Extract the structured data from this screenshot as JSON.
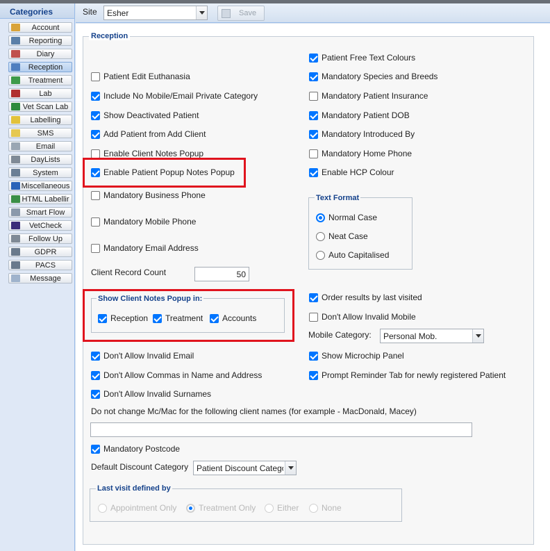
{
  "sidebar": {
    "title": "Categories",
    "items": [
      {
        "label": "Account",
        "icon": "account-icon",
        "color": "#d9a33a"
      },
      {
        "label": "Reporting",
        "icon": "reporting-icon",
        "color": "#5a7fa8"
      },
      {
        "label": "Diary",
        "icon": "diary-icon",
        "color": "#c0504d"
      },
      {
        "label": "Reception",
        "icon": "reception-icon",
        "color": "#4f7fc0",
        "active": true
      },
      {
        "label": "Treatment",
        "icon": "treatment-icon",
        "color": "#3d9a4a"
      },
      {
        "label": "Lab",
        "icon": "lab-icon",
        "color": "#b03030"
      },
      {
        "label": "Vet Scan Lab",
        "icon": "vetscan-icon",
        "color": "#2e8b3d"
      },
      {
        "label": "Labelling",
        "icon": "labelling-icon",
        "color": "#e2c23a"
      },
      {
        "label": "SMS",
        "icon": "sms-icon",
        "color": "#e6c850"
      },
      {
        "label": "Email",
        "icon": "email-icon",
        "color": "#9aa6b3"
      },
      {
        "label": "DayLists",
        "icon": "daylists-icon",
        "color": "#7f8a96"
      },
      {
        "label": "System",
        "icon": "system-icon",
        "color": "#6b7f95"
      },
      {
        "label": "Miscellaneous",
        "icon": "info-icon",
        "color": "#2a63b8"
      },
      {
        "label": "HTML Labellir",
        "icon": "html-labelling-icon",
        "color": "#3a8f46"
      },
      {
        "label": "Smart Flow",
        "icon": "smartflow-icon",
        "color": "#8a99ab"
      },
      {
        "label": "VetCheck",
        "icon": "vetcheck-icon",
        "color": "#3b2d7a"
      },
      {
        "label": "Follow Up",
        "icon": "followup-icon",
        "color": "#7f8a96"
      },
      {
        "label": "GDPR",
        "icon": "gdpr-icon",
        "color": "#6a7a8c"
      },
      {
        "label": "PACS",
        "icon": "pacs-icon",
        "color": "#6a7a8c"
      },
      {
        "label": "Message",
        "icon": "message-icon",
        "color": "#9fb3cc"
      }
    ]
  },
  "toolbar": {
    "site_label": "Site",
    "site_value": "Esher",
    "save_label": "Save"
  },
  "reception": {
    "legend": "Reception",
    "left": [
      {
        "label": "Patient Edit Euthanasia",
        "checked": false
      },
      {
        "label": "Include No Mobile/Email Private Category",
        "checked": true
      },
      {
        "label": "Show Deactivated Patient",
        "checked": true
      },
      {
        "label": "Add Patient from Add Client",
        "checked": true
      },
      {
        "label": "Enable Client Notes Popup",
        "checked": false
      },
      {
        "label": "Enable Patient Popup Notes Popup",
        "checked": true
      },
      {
        "label": "Mandatory Business Phone",
        "checked": false
      },
      {
        "label": "Mandatory Mobile Phone",
        "checked": false
      },
      {
        "label": "Mandatory Email Address",
        "checked": false
      }
    ],
    "right": [
      {
        "label": "Patient Free Text Colours",
        "checked": true
      },
      {
        "label": "Mandatory Species and Breeds",
        "checked": true
      },
      {
        "label": "Mandatory Patient Insurance",
        "checked": false
      },
      {
        "label": "Mandatory Patient DOB",
        "checked": true
      },
      {
        "label": "Mandatory Introduced By",
        "checked": true
      },
      {
        "label": "Mandatory Home Phone",
        "checked": false
      },
      {
        "label": "Enable HCP Colour",
        "checked": true
      }
    ],
    "text_format": {
      "legend": "Text Format",
      "options": [
        {
          "label": "Normal Case",
          "selected": true
        },
        {
          "label": "Neat Case",
          "selected": false
        },
        {
          "label": "Auto Capitalised",
          "selected": false
        }
      ]
    },
    "client_record_count": {
      "label": "Client Record Count",
      "value": "50"
    },
    "show_client_notes": {
      "legend": "Show Client Notes Popup in:",
      "options": [
        {
          "label": "Reception",
          "checked": true
        },
        {
          "label": "Treatment",
          "checked": true
        },
        {
          "label": "Accounts",
          "checked": true
        }
      ]
    },
    "right2": [
      {
        "label": "Order results by last visited",
        "checked": true
      },
      {
        "label": "Don't Allow Invalid Mobile",
        "checked": false
      }
    ],
    "mobile_category": {
      "label": "Mobile Category:",
      "value": "Personal Mob."
    },
    "right3": [
      {
        "label": "Show Microchip Panel",
        "checked": true
      },
      {
        "label": "Prompt Reminder Tab for newly registered Patient",
        "checked": true
      }
    ],
    "left2": [
      {
        "label": "Don't Allow Invalid Email",
        "checked": true
      },
      {
        "label": "Don't Allow Commas in Name and Address",
        "checked": true
      },
      {
        "label": "Don't Allow Invalid Surnames",
        "checked": true
      }
    ],
    "mcmac": {
      "label": "Do not change Mc/Mac for the following client names (for example - MacDonald, Macey)",
      "value": ""
    },
    "mandatory_postcode": {
      "label": "Mandatory Postcode",
      "checked": true
    },
    "discount": {
      "label": "Default Discount Category",
      "value": "Patient Discount Catego"
    },
    "last_visit": {
      "legend": "Last visit defined by",
      "options": [
        {
          "label": "Appointment Only",
          "selected": false
        },
        {
          "label": "Treatment Only",
          "selected": true
        },
        {
          "label": "Either",
          "selected": false
        },
        {
          "label": "None",
          "selected": false
        }
      ]
    }
  },
  "colors": {
    "accent": "#0075ff",
    "highlight": "#e0141e",
    "header_text": "#15428b"
  }
}
